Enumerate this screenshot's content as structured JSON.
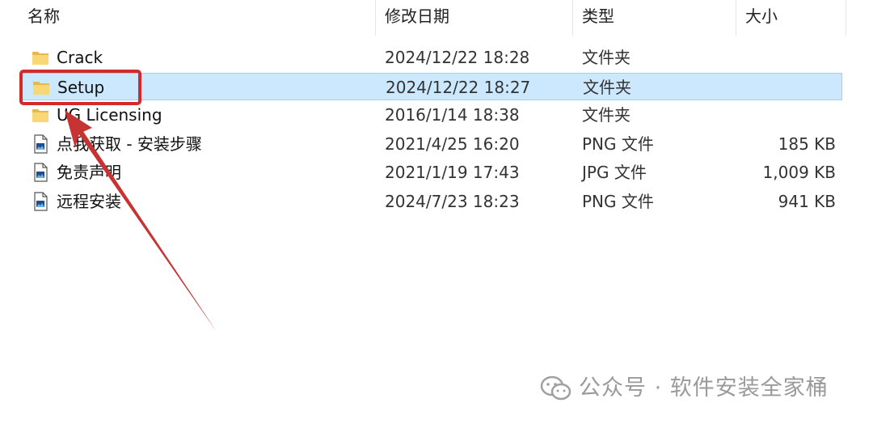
{
  "header": {
    "name": "名称",
    "modified": "修改日期",
    "type": "类型",
    "size": "大小",
    "sort_glyph": "^"
  },
  "files": [
    {
      "name": "Crack",
      "date": "2024/12/22 18:28",
      "type": "文件夹",
      "size": "",
      "icon": "folder-icon",
      "selected": false
    },
    {
      "name": "Setup",
      "date": "2024/12/22 18:27",
      "type": "文件夹",
      "size": "",
      "icon": "folder-icon",
      "selected": true
    },
    {
      "name": "UG Licensing",
      "date": "2016/1/14 18:38",
      "type": "文件夹",
      "size": "",
      "icon": "folder-icon",
      "selected": false
    },
    {
      "name": "点我获取 - 安装步骤",
      "date": "2021/4/25 16:20",
      "type": "PNG 文件",
      "size": "185 KB",
      "icon": "image-file-icon",
      "selected": false
    },
    {
      "name": "免责声明",
      "date": "2021/1/19 17:43",
      "type": "JPG 文件",
      "size": "1,009 KB",
      "icon": "image-file-icon",
      "selected": false
    },
    {
      "name": "远程安装",
      "date": "2024/7/23 18:23",
      "type": "PNG 文件",
      "size": "941 KB",
      "icon": "image-file-icon",
      "selected": false
    }
  ],
  "watermark": {
    "text": "公众号 · 软件安装全家桶",
    "icon": "wechat-icon"
  },
  "colors": {
    "selection_bg": "#cce8ff",
    "selection_border": "#99d1ff",
    "annotation_red": "#d42a2a",
    "folder_yellow": "#f8d775"
  }
}
